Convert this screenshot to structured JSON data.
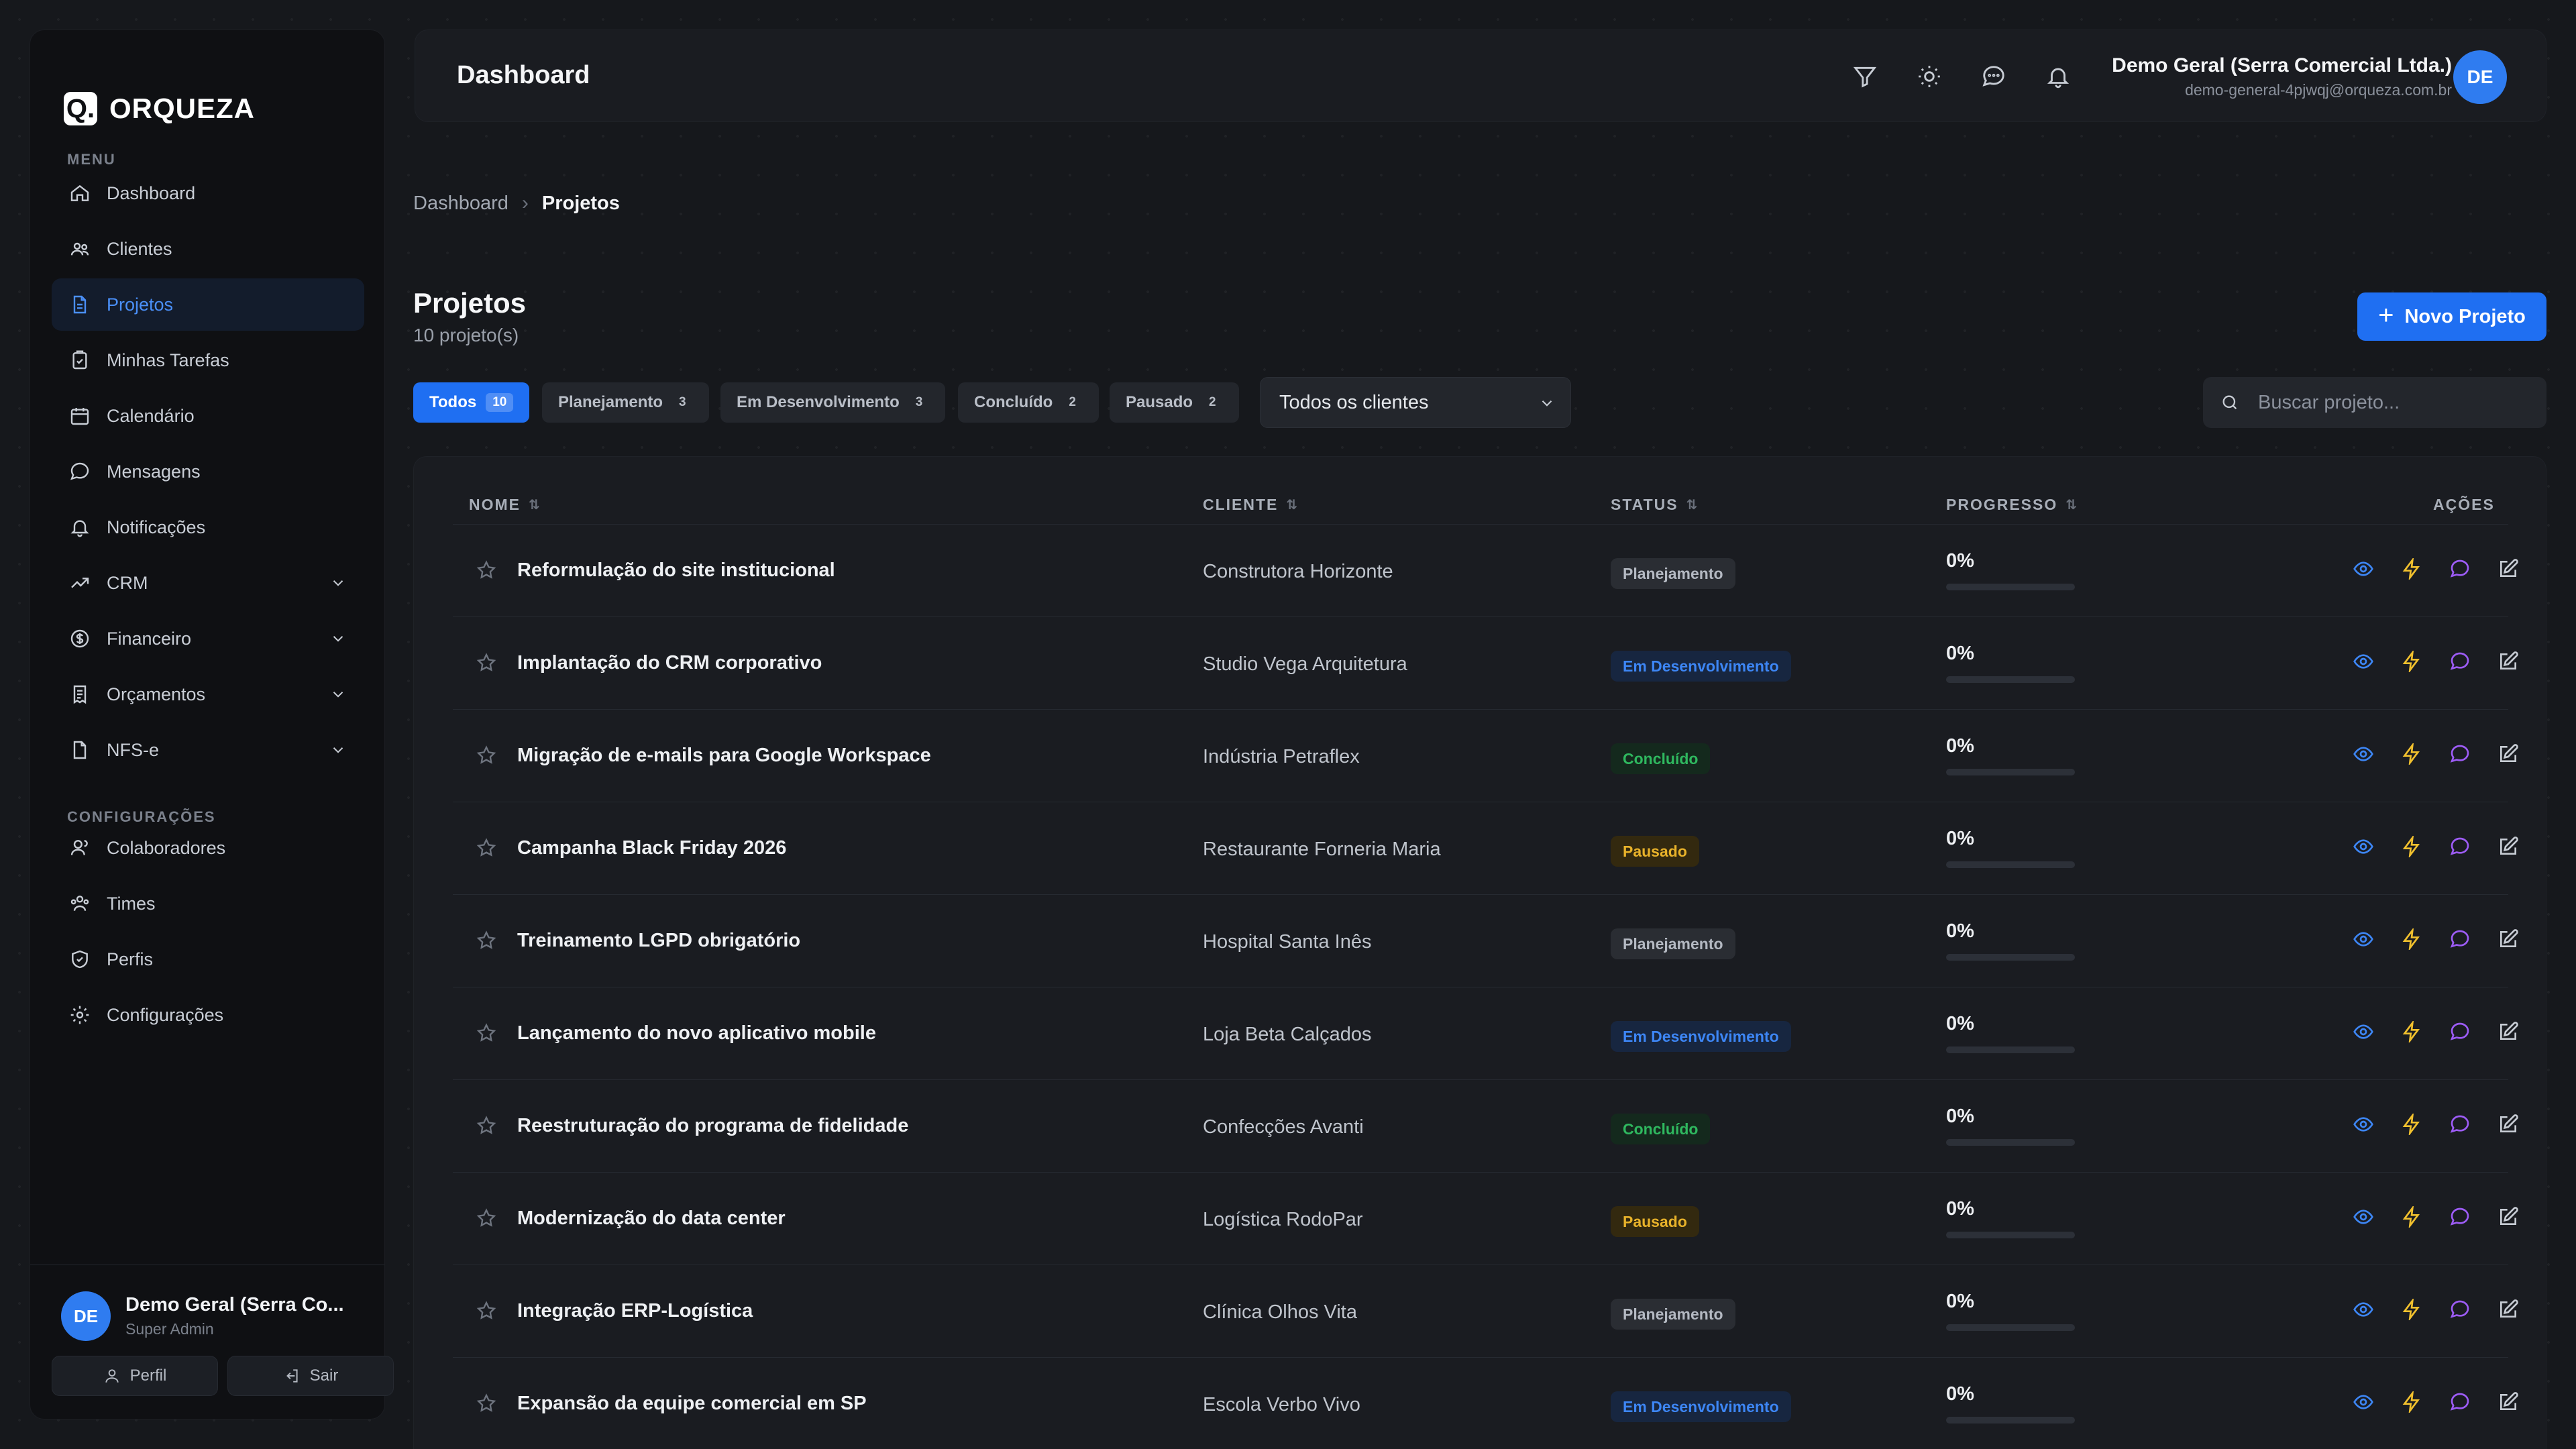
{
  "brand": {
    "mark": "Q.",
    "name": "ORQUEZA"
  },
  "sidebar": {
    "menu_label": "MENU",
    "config_label": "CONFIGURAÇÕES",
    "items": [
      {
        "label": "Dashboard",
        "icon": "home-icon"
      },
      {
        "label": "Clientes",
        "icon": "users-icon"
      },
      {
        "label": "Projetos",
        "icon": "document-icon",
        "active": true
      },
      {
        "label": "Minhas Tarefas",
        "icon": "clipboard-icon"
      },
      {
        "label": "Calendário",
        "icon": "calendar-icon"
      },
      {
        "label": "Mensagens",
        "icon": "chat-icon"
      },
      {
        "label": "Notificações",
        "icon": "bell-icon"
      },
      {
        "label": "CRM",
        "icon": "trend-icon",
        "expandable": true
      },
      {
        "label": "Financeiro",
        "icon": "dollar-icon",
        "expandable": true
      },
      {
        "label": "Orçamentos",
        "icon": "receipt-icon",
        "expandable": true
      },
      {
        "label": "NFS-e",
        "icon": "file-icon",
        "expandable": true
      }
    ],
    "config_items": [
      {
        "label": "Colaboradores",
        "icon": "user-group-icon"
      },
      {
        "label": "Times",
        "icon": "team-icon"
      },
      {
        "label": "Perfis",
        "icon": "shield-icon"
      },
      {
        "label": "Configurações",
        "icon": "gear-icon"
      }
    ],
    "user": {
      "initials": "DE",
      "name": "Demo Geral (Serra Co...",
      "role": "Super Admin"
    },
    "profile_label": "Perfil",
    "logout_label": "Sair"
  },
  "header": {
    "title": "Dashboard",
    "user_name": "Demo Geral (Serra Comercial Ltda.)",
    "user_email": "demo-general-4pjwqj@orqueza.com.br",
    "initials": "DE"
  },
  "breadcrumb": {
    "home": "Dashboard",
    "current": "Projetos"
  },
  "page": {
    "title": "Projetos",
    "count": "10 projeto(s)",
    "new_button": "Novo Projeto"
  },
  "filters": {
    "chips": [
      {
        "label": "Todos",
        "count": "10",
        "active": true
      },
      {
        "label": "Planejamento",
        "count": "3"
      },
      {
        "label": "Em Desenvolvimento",
        "count": "3"
      },
      {
        "label": "Concluído",
        "count": "2"
      },
      {
        "label": "Pausado",
        "count": "2"
      }
    ],
    "client_select": "Todos os clientes",
    "search_placeholder": "Buscar projeto..."
  },
  "table": {
    "columns": {
      "name": "NOME",
      "client": "CLIENTE",
      "status": "STATUS",
      "progress": "PROGRESSO",
      "actions": "AÇÕES"
    },
    "rows": [
      {
        "name": "Reformulação do site institucional",
        "client": "Construtora Horizonte",
        "status": "Planejamento",
        "progress": 0,
        "progress_label": "0%"
      },
      {
        "name": "Implantação do CRM corporativo",
        "client": "Studio Vega Arquitetura",
        "status": "Em Desenvolvimento",
        "progress": 0,
        "progress_label": "0%"
      },
      {
        "name": "Migração de e-mails para Google Workspace",
        "client": "Indústria Petraflex",
        "status": "Concluído",
        "progress": 0,
        "progress_label": "0%"
      },
      {
        "name": "Campanha Black Friday 2026",
        "client": "Restaurante Forneria Maria",
        "status": "Pausado",
        "progress": 0,
        "progress_label": "0%"
      },
      {
        "name": "Treinamento LGPD obrigatório",
        "client": "Hospital Santa Inês",
        "status": "Planejamento",
        "progress": 0,
        "progress_label": "0%"
      },
      {
        "name": "Lançamento do novo aplicativo mobile",
        "client": "Loja Beta Calçados",
        "status": "Em Desenvolvimento",
        "progress": 0,
        "progress_label": "0%"
      },
      {
        "name": "Reestruturação do programa de fidelidade",
        "client": "Confecções Avanti",
        "status": "Concluído",
        "progress": 0,
        "progress_label": "0%"
      },
      {
        "name": "Modernização do data center",
        "client": "Logística RodoPar",
        "status": "Pausado",
        "progress": 0,
        "progress_label": "0%"
      },
      {
        "name": "Integração ERP-Logística",
        "client": "Clínica Olhos Vita",
        "status": "Planejamento",
        "progress": 0,
        "progress_label": "0%"
      },
      {
        "name": "Expansão da equipe comercial em SP",
        "client": "Escola Verbo Vivo",
        "status": "Em Desenvolvimento",
        "progress": 0,
        "progress_label": "0%"
      }
    ]
  },
  "status_colors": {
    "Planejamento": {
      "bg": "#2a2d33",
      "fg": "#b4b9c2"
    },
    "Em Desenvolvimento": {
      "bg": "#172640",
      "fg": "#3d86f5"
    },
    "Concluído": {
      "bg": "#14291d",
      "fg": "#2fb85f"
    },
    "Pausado": {
      "bg": "#33290f",
      "fg": "#e8b22a"
    }
  },
  "colors": {
    "accent": "#1f6ff2",
    "action_view": "#3d86f5",
    "action_bolt": "#f2c12e",
    "action_chat": "#9d5cf6",
    "action_edit": "#c7ccd4"
  }
}
